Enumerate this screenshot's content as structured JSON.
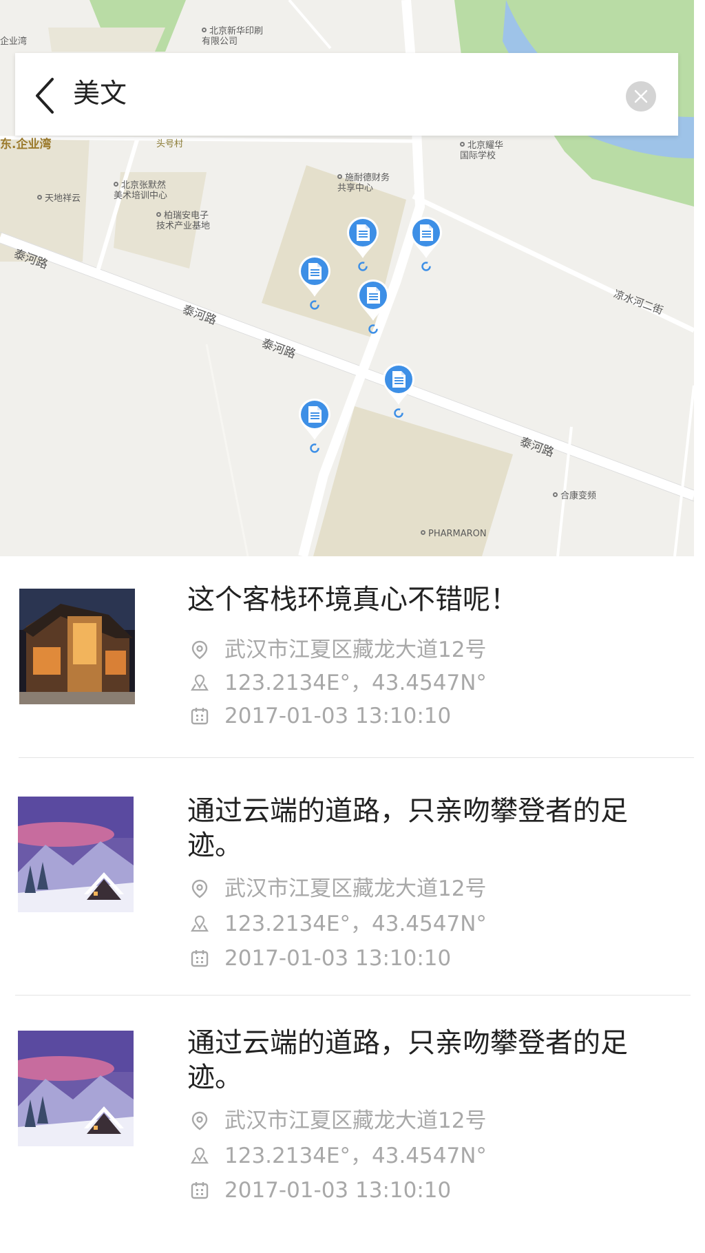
{
  "search": {
    "query": "美文",
    "back_icon": "chevron-left-icon",
    "clear_icon": "close-circle-icon"
  },
  "map": {
    "pois": [
      {
        "text": "北京新华印刷\n有限公司"
      },
      {
        "text": "北京耀华\n国际学校"
      },
      {
        "text": "施耐德财务\n共享中心"
      },
      {
        "text": "北京张默然\n美术培训中心"
      },
      {
        "text": "天地祥云"
      },
      {
        "text": "柏瑞安电子\n技术产业基地"
      },
      {
        "text": "合康变频"
      },
      {
        "text": "PHARMARON"
      }
    ],
    "roads": [
      "泰河路",
      "泰河路",
      "泰河路",
      "泰河路",
      "凉水河二街"
    ],
    "district": "东.企业湾",
    "district_top": "企业湾",
    "village": "头号村",
    "pin_icon": "document-pin-icon",
    "pin_count": 6
  },
  "list": [
    {
      "title": "这个客栈环境真心不错呢！",
      "address": "武汉市江夏区藏龙大道12号",
      "coords": "123.2134E°，43.4547N°",
      "datetime": "2017-01-03  13:10:10",
      "thumb": "inn-night-photo"
    },
    {
      "title": "通过云端的道路，只亲吻攀登者的足迹。",
      "address": "武汉市江夏区藏龙大道12号",
      "coords": "123.2134E°，43.4547N°",
      "datetime": "2017-01-03  13:10:10",
      "thumb": "snow-cabin-photo"
    },
    {
      "title": "通过云端的道路，只亲吻攀登者的足迹。",
      "address": "武汉市江夏区藏龙大道12号",
      "coords": "123.2134E°，43.4547N°",
      "datetime": "2017-01-03  13:10:10",
      "thumb": "snow-cabin-photo"
    }
  ],
  "colors": {
    "pin": "#3d8fe6",
    "meta_text": "#a8a8a8",
    "title_text": "#222222",
    "map_bg": "#f1f0ec"
  }
}
